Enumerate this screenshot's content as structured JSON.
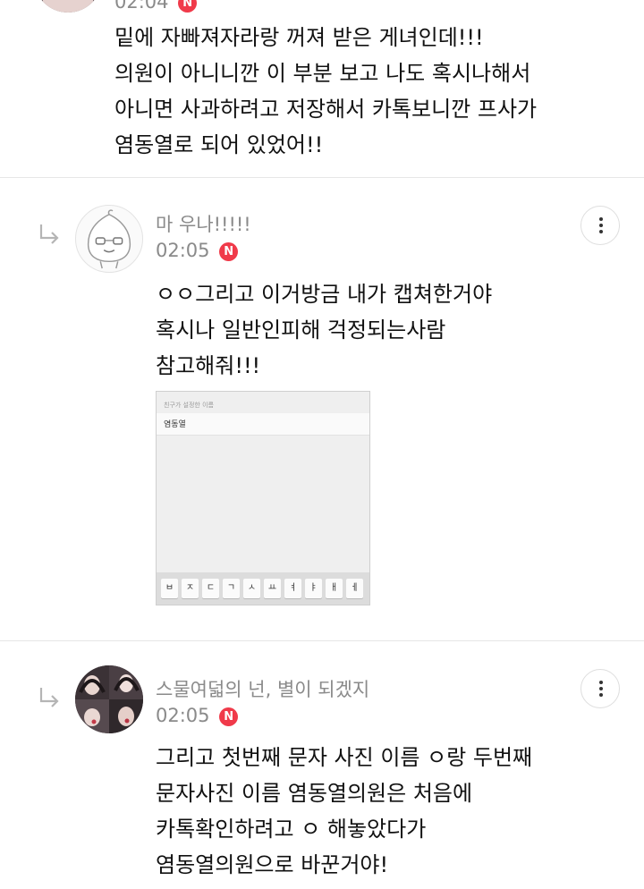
{
  "top_comment": {
    "time_partial": "02:04",
    "lines": "밑에 자빠져자라랑 꺼져 받은 게녀인데!!!\n의원이 아니니깐 이 부분 보고 나도 혹시나해서\n아니면 사과하려고 저장해서 카톡보니깐 프사가\n염동열로 되어 있었어!!"
  },
  "comments": [
    {
      "author": "마 우나!!!!!",
      "time": "02:05",
      "badge": "N",
      "avatar_icon": "cartoon-face-avatar",
      "lines": "ㅇㅇ그리고 이거방금 내가 캡쳐한거야\n혹시나 일반인피해 걱정되는사람\n참고해줘!!!",
      "attachment": {
        "label": "친구가 설정한 이름",
        "value": "염동열",
        "keys": [
          "ㅂ",
          "ㅈ",
          "ㄷ",
          "ㄱ",
          "ㅅ",
          "ㅛ",
          "ㅕ",
          "ㅑ",
          "ㅐ",
          "ㅔ"
        ]
      }
    },
    {
      "author": "스물여덟의 넌, 별이 되겠지",
      "time": "02:05",
      "badge": "N",
      "avatar_icon": "photo-collage-avatar",
      "lines": "그리고 첫번째 문자 사진 이름 ㅇ랑 두번째\n문자사진 이름 염동열의원은 처음에\n카톡확인하려고 ㅇ 해놓았다가\n염동열의원으로 바꾼거야!"
    }
  ],
  "icons": {
    "reply_arrow": "reply-arrow-icon",
    "more": "more-vertical-icon"
  },
  "colors": {
    "badge_red": "#f03a4a",
    "meta_gray": "#8a8a8a"
  }
}
